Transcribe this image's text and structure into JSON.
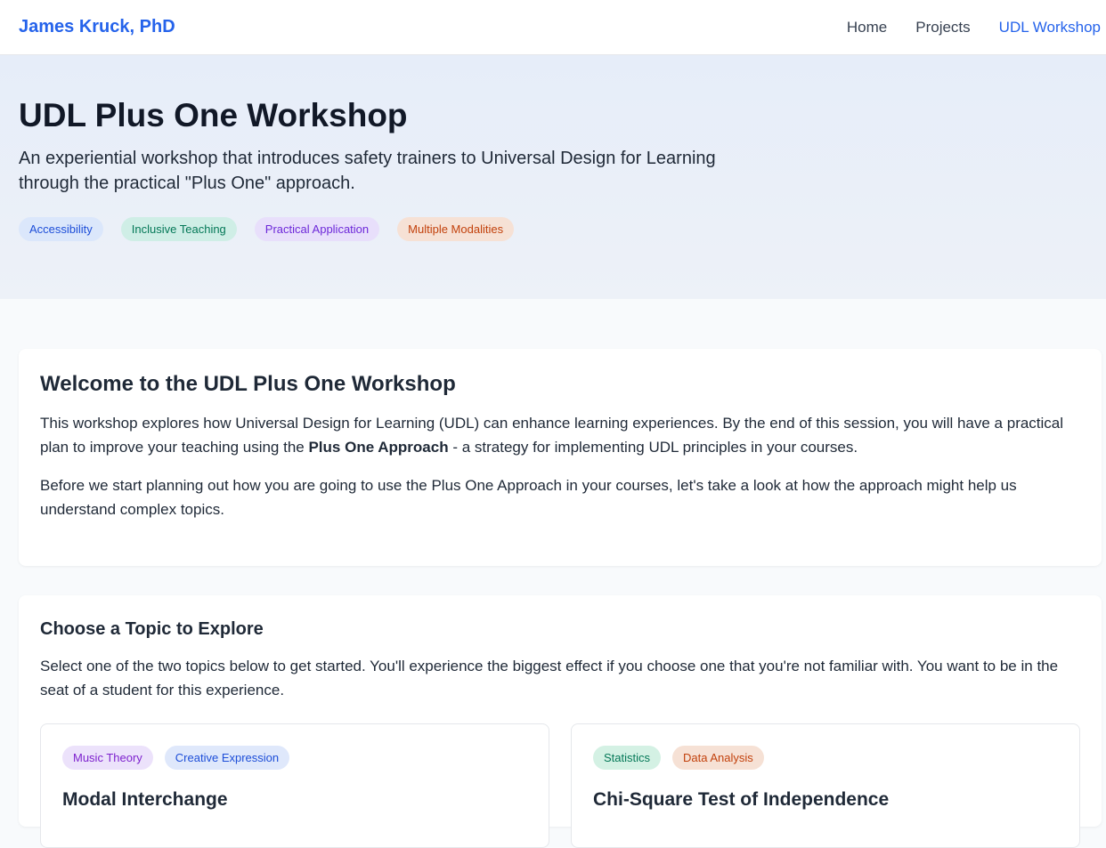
{
  "nav": {
    "brand": "James Kruck, PhD",
    "links": [
      {
        "label": "Home"
      },
      {
        "label": "Projects"
      },
      {
        "label": "UDL Workshop"
      }
    ]
  },
  "hero": {
    "title": "UDL Plus One Workshop",
    "subtitle": "An experiential workshop that introduces safety trainers to Universal Design for Learning through the practical \"Plus One\" approach.",
    "tags": [
      "Accessibility",
      "Inclusive Teaching",
      "Practical Application",
      "Multiple Modalities"
    ]
  },
  "welcome": {
    "heading": "Welcome to the UDL Plus One Workshop",
    "p1_before": "This workshop explores how Universal Design for Learning (UDL) can enhance learning experiences. By the end of this session, you will have a practical plan to improve your teaching using the ",
    "p1_bold": "Plus One Approach",
    "p1_after": " - a strategy for implementing UDL principles in your courses.",
    "p2": "Before we start planning out how you are going to use the Plus One Approach in your courses, let's take a look at how the approach might help us understand complex topics."
  },
  "explore": {
    "heading": "Choose a Topic to Explore",
    "description": "Select one of the two topics below to get started. You'll experience the biggest effect if you choose one that you're not familiar with. You want to be in the seat of a student for this experience.",
    "topics": [
      {
        "title": "Modal Interchange",
        "tags": [
          "Music Theory",
          "Creative Expression"
        ]
      },
      {
        "title": "Chi-Square Test of Independence",
        "tags": [
          "Statistics",
          "Data Analysis"
        ]
      }
    ]
  }
}
